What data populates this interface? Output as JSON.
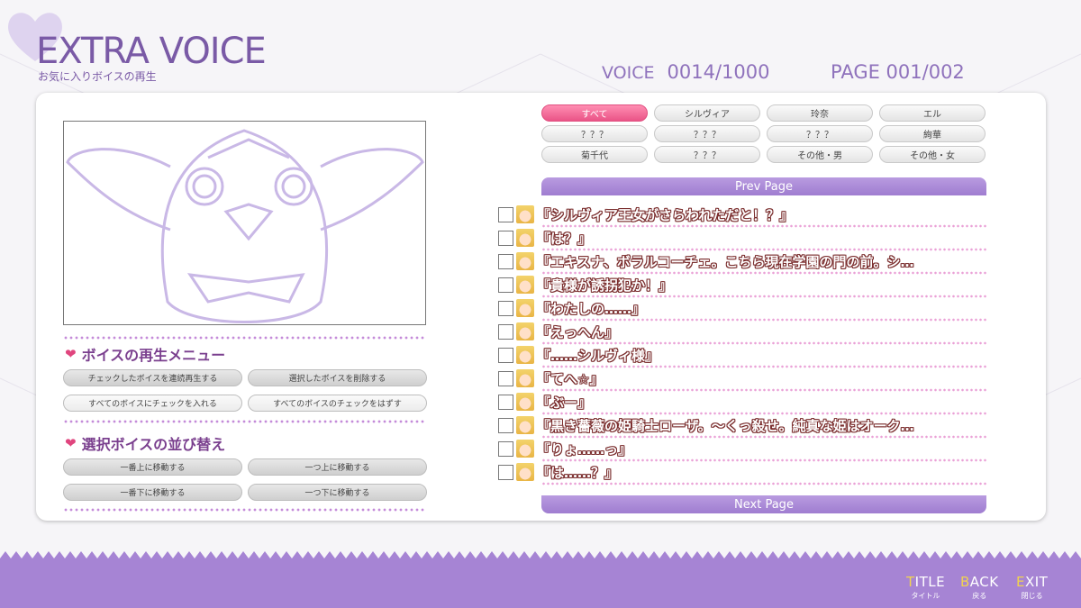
{
  "header": {
    "title": "EXTRA VOICE",
    "subtitle": "お気に入りボイスの再生",
    "voice_label": "VOICE",
    "voice_count": "0014/1000",
    "page_label": "PAGE",
    "page_value": "001/002"
  },
  "menu": {
    "play_heading": "ボイスの再生メニュー",
    "play_buttons": [
      "チェックしたボイスを連続再生する",
      "選択したボイスを削除する",
      "すべてのボイスにチェックを入れる",
      "すべてのボイスのチェックをはずす"
    ],
    "sort_heading": "選択ボイスの並び替え",
    "sort_buttons": [
      "一番上に移動する",
      "一つ上に移動する",
      "一番下に移動する",
      "一つ下に移動する"
    ]
  },
  "tags": [
    "すべて",
    "シルヴィア",
    "玲奈",
    "エル",
    "？？？",
    "？？？",
    "？？？",
    "絢華",
    "菊千代",
    "？？？",
    "その他・男",
    "その他・女"
  ],
  "active_tag": "すべて",
  "list": {
    "prev_label": "Prev Page",
    "next_label": "Next Page",
    "voices": [
      "『シルヴィア王女がさらわれただと！？』",
      "『は？』",
      "『エキスナ、ボラルコーチェ。こちら現在学園の門の前。シ…',",
      "『貴様が誘拐犯か！』",
      "『わたしの……』",
      "『えっへん』",
      "『……シルヴィ様』",
      "『てへ☆』",
      "『ぶー』",
      "『黒き薔薇の姫騎士ローザ。～くっ殺せ。純真な姫はオーク…",
      "『りょ……っ』",
      "『は……？』"
    ]
  },
  "nav": [
    {
      "first": "T",
      "rest": "ITLE",
      "sub": "タイトル"
    },
    {
      "first": "B",
      "rest": "ACK",
      "sub": "戻る"
    },
    {
      "first": "E",
      "rest": "XIT",
      "sub": "閉じる"
    }
  ],
  "colors": {
    "accent": "#9f7dd0",
    "active_tag": "#ea5487",
    "heading": "#7a3f8e"
  }
}
